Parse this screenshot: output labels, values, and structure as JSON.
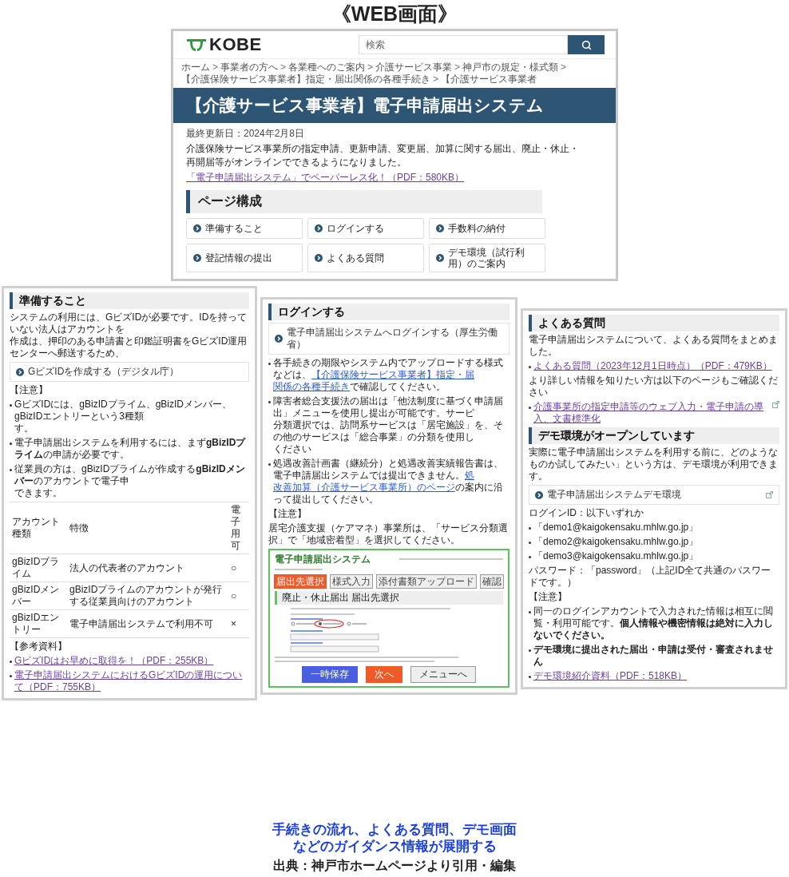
{
  "title": "《WEB画面》",
  "web_page": {
    "logo": "KOBE",
    "search": {
      "placeholder": "検索"
    },
    "breadcrumb": {
      "separator": ">",
      "items": [
        "ホーム",
        "事業者の方へ",
        "各業種へのご案内",
        "介護サービス事業",
        "神戸市の規定・様式類",
        "【介護保険サービス事業者】指定・届出関係の各種手続き",
        "【介護サービス事業者"
      ]
    },
    "banner_title": "【介護サービス事業者】電子申請届出システム",
    "updated": "最終更新日：2024年2月8日",
    "intro": "介護保険サービス事業所の指定申請、更新申請、変更届、加算に関する届出、廃止・休止・再開届等がオンラインでできるようになりました。",
    "pdf_link": "「電子申請届出システム」でペーパーレス化！（PDF：580KB）",
    "section_heading": "ページ構成",
    "nav_cards": [
      "準備すること",
      "ログインする",
      "手数料の納付",
      "登記情報の提出",
      "よくある質問",
      "デモ環境（試行利用）のご案内"
    ]
  },
  "panels": [
    {
      "blocks": [
        {
          "kind": "heading",
          "text": "準備すること"
        },
        {
          "kind": "cut_text",
          "lines": [
            "システムの利用には、GビズIDが必要です。IDを持っていない法人はアカウントを",
            "作成は、押印のある申請書と印鑑証明書をGビズID運用センターへ郵送するため、"
          ]
        },
        {
          "kind": "link_box",
          "text": "GビズIDを作成する（デジタル庁）",
          "external": false
        },
        {
          "kind": "text",
          "text": "【注意】",
          "bullet": false
        },
        {
          "kind": "cut_text",
          "bullet": true,
          "lines": [
            "GビズIDには、gBizIDプライム、gBizIDメンバー、gBizIDエントリーという3種類",
            "す。"
          ]
        },
        {
          "kind": "text",
          "bullet": true,
          "text": "電子申請届出システムを利用するには、まず**gBizIDプライム**の申請が必要です。"
        },
        {
          "kind": "cut_text",
          "bullet": true,
          "lines": [
            "従業員の方は、gBizIDプライムが作成する**gBizIDメンバー**のアカウントで電子申",
            "できます。"
          ]
        },
        {
          "kind": "table",
          "columns": [
            "アカウント種類",
            "特徴",
            "電子用可"
          ],
          "rows": [
            [
              "gBizIDプライム",
              "法人の代表者のアカウント",
              "○"
            ],
            [
              "gBizIDメンバー",
              "gBizIDプライムのアカウントが発行する従業員向けのアカウント",
              "○"
            ],
            [
              "gBizIDエントリー",
              "電子申請届出システムで利用不可",
              "×"
            ]
          ]
        },
        {
          "kind": "text",
          "text": "【参考資料】",
          "bullet": false
        },
        {
          "kind": "link",
          "bullet": true,
          "external": false,
          "text": "GビズIDはお早めに取得を！（PDF：255KB）"
        },
        {
          "kind": "link",
          "bullet": true,
          "external": false,
          "text": "電子申請届出システムにおけるGビズIDの運用について（PDF：755KB）"
        }
      ]
    },
    {
      "blocks": [
        {
          "kind": "heading",
          "text": "ログインする"
        },
        {
          "kind": "link_box",
          "text": "電子申請届出システムへログインする（厚生労働省）",
          "external": false
        },
        {
          "kind": "linked_text",
          "bullet": true,
          "segments": [
            {
              "text": "各手続きの期限やシステム内でアップロードする様式などは、",
              "link": false
            },
            {
              "text": "【介護保険サービス事業者】指定・届",
              "link": true
            },
            {
              "text": "関係の各種手続き",
              "link": true
            },
            {
              "text": "で確認してください。",
              "link": false
            }
          ]
        },
        {
          "kind": "cut_text",
          "bullet": true,
          "lines": [
            "障害者総合支援法の届出は「他法制度に基づく申請届出」メニューを使用し提出が可能です。サービ",
            "分類選択では、訪問系サービスは「居宅施設」を、その他のサービスは「総合事業」の分類を使用し",
            "ください"
          ]
        },
        {
          "kind": "linked_text",
          "bullet": true,
          "segments": [
            {
              "text": "処遇改善計画書（継続分）と処遇改善実績報告書は、電子申請届出システムでは提出できません。",
              "link": false
            },
            {
              "text": "処",
              "link": true
            },
            {
              "text": "改善加算（介護サービス事業所）のページ",
              "link": true
            },
            {
              "text": "の案内に沿って提出してください。",
              "link": false
            }
          ]
        },
        {
          "kind": "text",
          "text": "【注意】",
          "bullet": false
        },
        {
          "kind": "text",
          "bullet": false,
          "text": "居宅介護支援（ケアマネ）事業所は、「サービス分類選択」で「地域密着型」を選択してください。"
        },
        {
          "kind": "screenshot",
          "app_title": "電子申請届出システム",
          "steps": [
            {
              "text": "届出先選択",
              "selected": true
            },
            {
              "text": "様式入力",
              "selected": false
            },
            {
              "text": "添付書類アップロード",
              "selected": false
            },
            {
              "text": "確認",
              "selected": false
            }
          ],
          "section_heading": "廃止・休止届出 届出先選択",
          "buttons": [
            {
              "text": "一時保存",
              "kind": "save"
            },
            {
              "text": "次へ",
              "kind": "next"
            },
            {
              "text": "メニューへ",
              "kind": "menu"
            }
          ]
        }
      ]
    },
    {
      "blocks": [
        {
          "kind": "heading",
          "text": "よくある質問"
        },
        {
          "kind": "text",
          "bullet": false,
          "text": "電子申請届出システムについて、よくある質問をまとめました。"
        },
        {
          "kind": "link",
          "bullet": true,
          "external": false,
          "text": "よくある質問（2023年12月1日時点）（PDF：479KB）"
        },
        {
          "kind": "text",
          "bullet": false,
          "text": "より詳しい情報を知りたい方は以下のページもご確認ください"
        },
        {
          "kind": "link",
          "bullet": true,
          "external": true,
          "text": "介護事業所の指定申請等のウェブ入力・電子申請の導入、文書標準化"
        },
        {
          "kind": "heading",
          "text": "デモ環境がオープンしています"
        },
        {
          "kind": "text",
          "bullet": false,
          "text": "実際に電子申請届出システムを利用する前に、どのようなものか試してみたい」という方は、デモ環境が利用できます。"
        },
        {
          "kind": "link_box",
          "text": "電子申請届出システムデモ環境",
          "external": true
        },
        {
          "kind": "text",
          "bullet": false,
          "text": "ログインID：以下いずれか"
        },
        {
          "kind": "text",
          "bullet": true,
          "text": "「demo1@kaigokensaku.mhlw.go.jp」"
        },
        {
          "kind": "text",
          "bullet": true,
          "text": "「demo2@kaigokensaku.mhlw.go.jp」"
        },
        {
          "kind": "text",
          "bullet": true,
          "text": "「demo3@kaigokensaku.mhlw.go.jp」"
        },
        {
          "kind": "text",
          "bullet": false,
          "text": "パスワード：「password」（上記ID全て共通のパスワードです。）"
        },
        {
          "kind": "text",
          "bullet": false,
          "text": "【注意】"
        },
        {
          "kind": "text",
          "bullet": true,
          "text": "同一のログインアカウントで入力された情報は相互に閲覧・利用可能です。**個人情報や機密情報は絶対に入力しないでください。**"
        },
        {
          "kind": "text",
          "bullet": true,
          "bold": true,
          "text": "デモ環境に提出された届出・申請は受付・審査されません"
        },
        {
          "kind": "link",
          "bullet": true,
          "external": false,
          "text": "デモ環境紹介資料（PDF：518KB）"
        }
      ]
    }
  ],
  "caption": [
    "手続きの流れ、よくある質問、デモ画面",
    "などのガイダンス情報が展開する"
  ],
  "source": "出典：神戸市ホームページより引用・編集"
}
